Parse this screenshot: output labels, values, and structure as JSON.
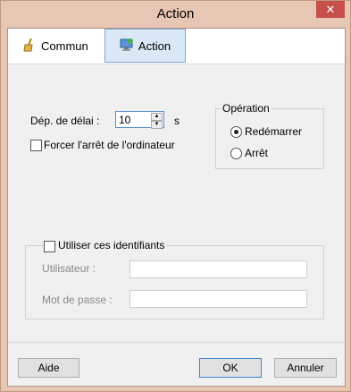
{
  "window": {
    "title": "Action",
    "close_glyph": "✕"
  },
  "tabs": [
    {
      "label": "Commun",
      "icon": "broom-icon",
      "selected": false
    },
    {
      "label": "Action",
      "icon": "computer-icon",
      "selected": true
    }
  ],
  "delay": {
    "label": "Dép. de délai :",
    "value": "10",
    "unit": "s"
  },
  "force_shutdown": {
    "label": "Forcer l'arrêt de l'ordinateur",
    "checked": false
  },
  "operation": {
    "title": "Opération",
    "options": [
      {
        "label": "Redémarrer",
        "selected": true
      },
      {
        "label": "Arrêt",
        "selected": false
      }
    ]
  },
  "credentials": {
    "checkbox_label": "Utiliser ces identifiants",
    "checked": false,
    "user_label": "Utilisateur :",
    "password_label": "Mot de passe :"
  },
  "buttons": {
    "help": "Aide",
    "ok": "OK",
    "cancel": "Annuler"
  }
}
